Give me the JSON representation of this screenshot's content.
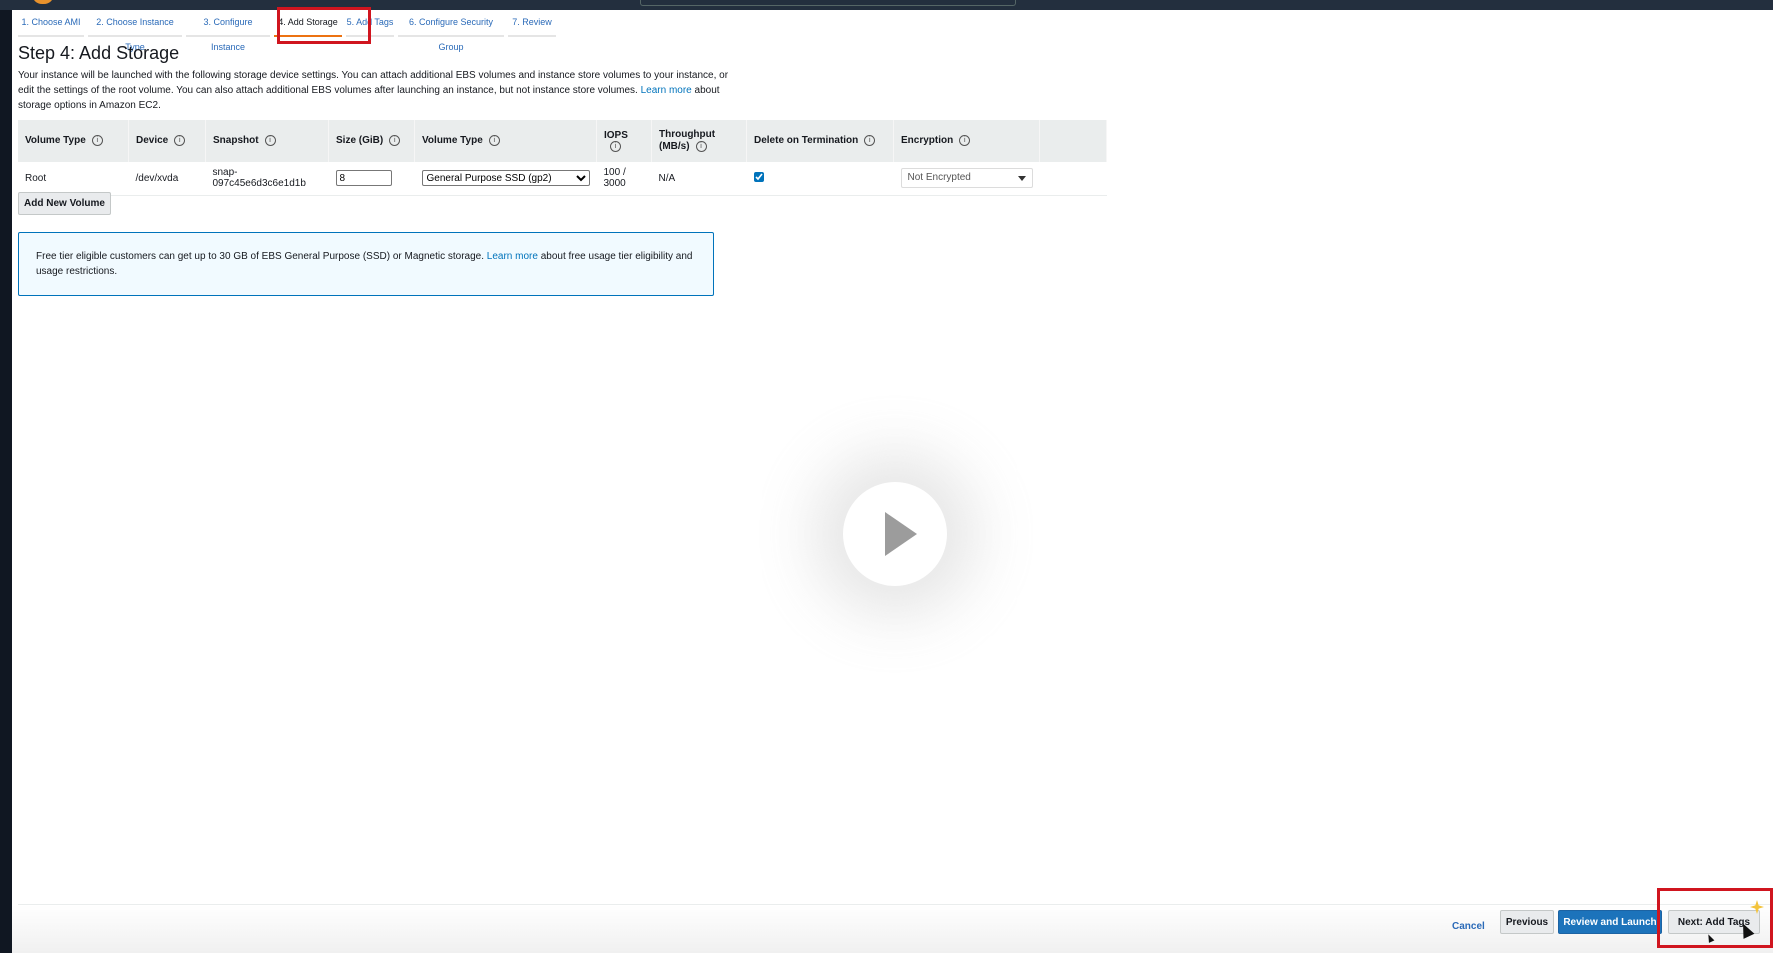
{
  "wizard": {
    "tabs": [
      {
        "label": "1. Choose AMI"
      },
      {
        "label": "2. Choose Instance Type"
      },
      {
        "label": "3. Configure Instance"
      },
      {
        "label": "4. Add Storage"
      },
      {
        "label": "5. Add Tags"
      },
      {
        "label": "6. Configure Security Group"
      },
      {
        "label": "7. Review"
      }
    ],
    "active_tab": "4. Add Storage"
  },
  "page": {
    "title": "Step 4: Add Storage",
    "description": "Your instance will be launched with the following storage device settings. You can attach additional EBS volumes and instance store volumes to your instance, or edit the settings of the root volume. You can also attach additional EBS volumes after launching an instance, but not instance store volumes.",
    "description_link": "Learn more",
    "description_tail": "about storage options in Amazon EC2."
  },
  "table": {
    "headers": {
      "volume_type": "Volume Type",
      "device": "Device",
      "snapshot": "Snapshot",
      "size": "Size (GiB)",
      "volume_type_2": "Volume Type",
      "iops": "IOPS",
      "throughput": "Throughput (MB/s)",
      "delete_on_termination": "Delete on Termination",
      "encryption": "Encryption"
    },
    "rows": [
      {
        "volume_type": "Root",
        "device": "/dev/xvda",
        "snapshot": "snap-097c45e6d3c6e1d1b",
        "size": "8",
        "ebs_type": "General Purpose SSD (gp2)",
        "iops": "100 / 3000",
        "throughput": "N/A",
        "delete_on_termination": true,
        "encryption": "Not Encrypted"
      }
    ]
  },
  "add_volume_label": "Add New Volume",
  "info_box": {
    "text": "Free tier eligible customers can get up to 30 GB of EBS General Purpose (SSD) or Magnetic storage.",
    "link": "Learn more",
    "tail": "about free usage tier eligibility and usage restrictions."
  },
  "footer": {
    "cancel": "Cancel",
    "previous": "Previous",
    "review_launch": "Review and Launch",
    "next": "Next: Add Tags"
  },
  "colors": {
    "accent_orange": "#ec7211",
    "link_blue": "#0073bb",
    "primary_button": "#1c73bb",
    "highlight_red": "#d0151f"
  },
  "icons": {
    "info": "info-icon",
    "play": "play-icon",
    "dropdown": "chevron-down-icon",
    "cursor": "mouse-cursor-icon"
  }
}
